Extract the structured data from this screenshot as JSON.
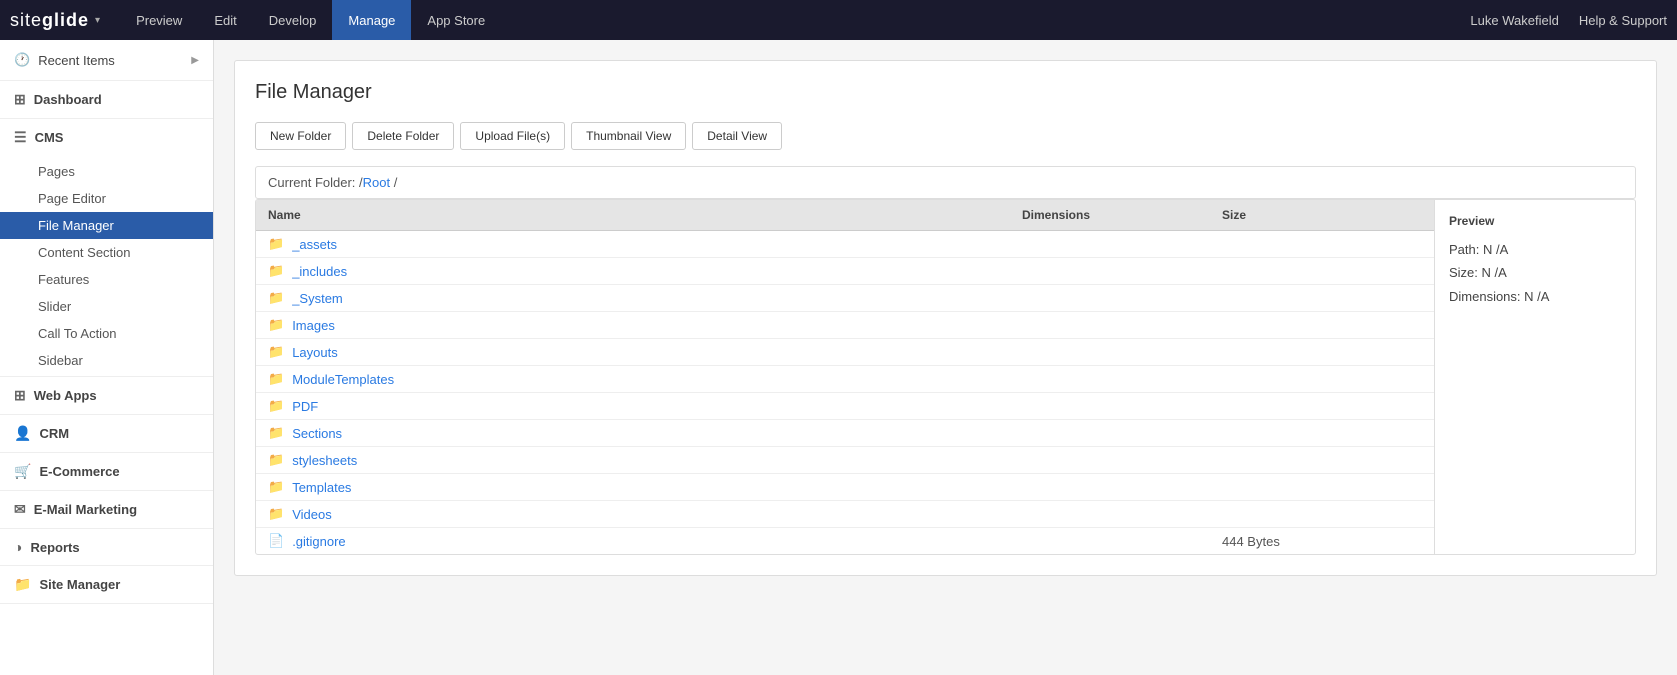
{
  "topNav": {
    "logoText": "siteglide",
    "navItems": [
      {
        "label": "Preview",
        "active": false
      },
      {
        "label": "Edit",
        "active": false
      },
      {
        "label": "Develop",
        "active": false
      },
      {
        "label": "Manage",
        "active": true
      },
      {
        "label": "App Store",
        "active": false
      }
    ],
    "rightItems": [
      {
        "label": "Luke Wakefield"
      },
      {
        "label": "Help & Support"
      }
    ]
  },
  "sidebar": {
    "recentItems": "Recent Items",
    "sections": [
      {
        "label": "Dashboard",
        "icon": "grid-icon",
        "iconChar": "⊞",
        "items": []
      },
      {
        "label": "CMS",
        "icon": "cms-icon",
        "iconChar": "☰",
        "items": [
          {
            "label": "Pages",
            "active": false
          },
          {
            "label": "Page Editor",
            "active": false
          },
          {
            "label": "File Manager",
            "active": true
          },
          {
            "label": "Content Section",
            "active": false
          },
          {
            "label": "Features",
            "active": false
          },
          {
            "label": "Slider",
            "active": false
          },
          {
            "label": "Call To Action",
            "active": false
          },
          {
            "label": "Sidebar",
            "active": false
          }
        ]
      },
      {
        "label": "Web Apps",
        "icon": "webapp-icon",
        "iconChar": "⊞",
        "items": []
      },
      {
        "label": "CRM",
        "icon": "crm-icon",
        "iconChar": "👤",
        "items": []
      },
      {
        "label": "E-Commerce",
        "icon": "ecommerce-icon",
        "iconChar": "🛒",
        "items": []
      },
      {
        "label": "E-Mail Marketing",
        "icon": "email-icon",
        "iconChar": "✉",
        "items": []
      },
      {
        "label": "Reports",
        "icon": "reports-icon",
        "iconChar": "◑",
        "items": []
      },
      {
        "label": "Site Manager",
        "icon": "site-icon",
        "iconChar": "📁",
        "items": []
      }
    ]
  },
  "main": {
    "pageTitle": "File Manager",
    "toolbar": {
      "buttons": [
        {
          "label": "New Folder"
        },
        {
          "label": "Delete Folder"
        },
        {
          "label": "Upload File(s)"
        },
        {
          "label": "Thumbnail View"
        },
        {
          "label": "Detail View"
        }
      ]
    },
    "breadcrumb": {
      "prefix": "Current Folder: /",
      "link": "Root",
      "suffix": " /"
    },
    "tableHeaders": {
      "name": "Name",
      "dimensions": "Dimensions",
      "size": "Size"
    },
    "previewHeader": "Preview",
    "previewInfo": {
      "path": "Path: N /A",
      "size": "Size: N /A",
      "dimensions": "Dimensions: N /A"
    },
    "folders": [
      {
        "name": "_assets",
        "type": "folder",
        "dimensions": "",
        "size": ""
      },
      {
        "name": "_includes",
        "type": "folder",
        "dimensions": "",
        "size": ""
      },
      {
        "name": "_System",
        "type": "folder",
        "dimensions": "",
        "size": ""
      },
      {
        "name": "Images",
        "type": "folder",
        "dimensions": "",
        "size": ""
      },
      {
        "name": "Layouts",
        "type": "folder",
        "dimensions": "",
        "size": ""
      },
      {
        "name": "ModuleTemplates",
        "type": "folder",
        "dimensions": "",
        "size": ""
      },
      {
        "name": "PDF",
        "type": "folder",
        "dimensions": "",
        "size": ""
      },
      {
        "name": "Sections",
        "type": "folder",
        "dimensions": "",
        "size": ""
      },
      {
        "name": "stylesheets",
        "type": "folder",
        "dimensions": "",
        "size": ""
      },
      {
        "name": "Templates",
        "type": "folder",
        "dimensions": "",
        "size": ""
      },
      {
        "name": "Videos",
        "type": "folder",
        "dimensions": "",
        "size": ""
      },
      {
        "name": ".gitignore",
        "type": "file",
        "dimensions": "",
        "size": "444 Bytes"
      }
    ]
  }
}
